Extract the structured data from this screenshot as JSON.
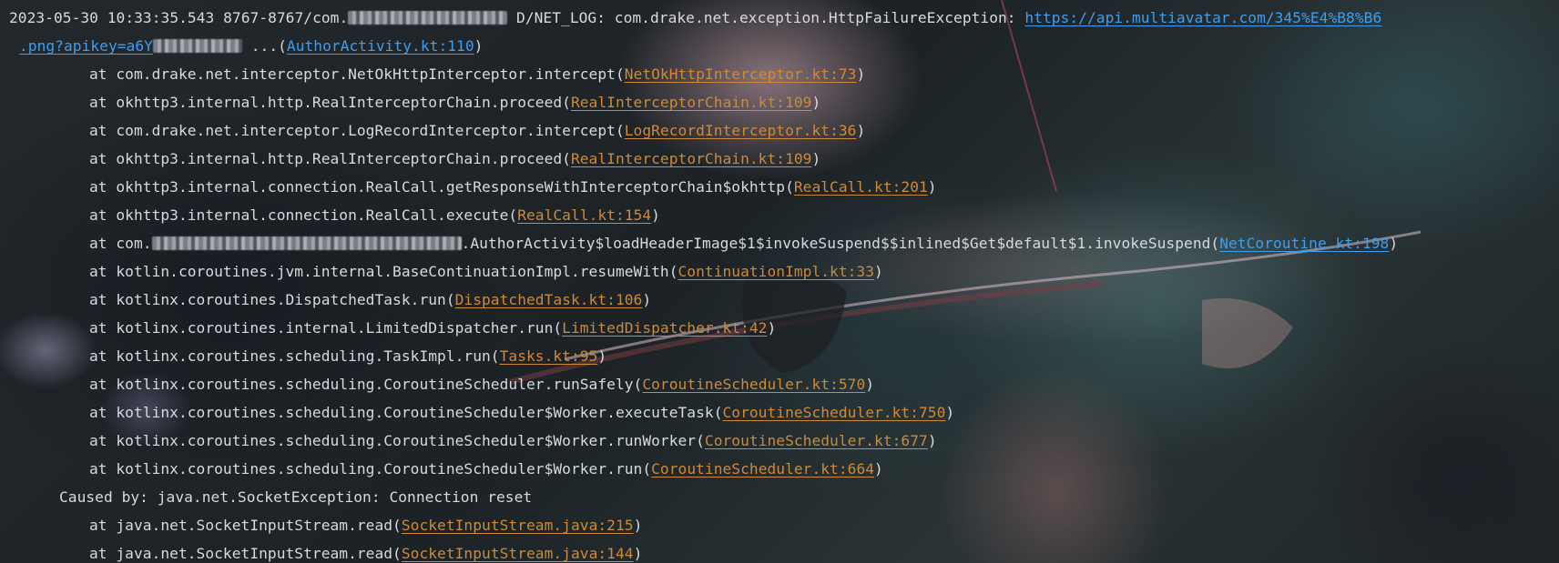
{
  "log": {
    "header": {
      "timestamp": "2023-05-30 10:33:35.543",
      "pid_prefix": "8767-8767/com.",
      "tag_text": " D/NET_LOG: com.drake.net.exception.HttpFailureException: ",
      "url_part1": "https://api.multiavatar.com/345%E4%B8%B6",
      "url_part2": ".png?apikey=a6Y",
      "after_key": " ...(",
      "author_link": "AuthorActivity.kt:110",
      "close": ")"
    },
    "stack": [
      {
        "method": "at com.drake.net.interceptor.NetOkHttpInterceptor.intercept(",
        "link": "NetOkHttpInterceptor.kt:73",
        "color": "orange"
      },
      {
        "method": "at okhttp3.internal.http.RealInterceptorChain.proceed(",
        "link": "RealInterceptorChain.kt:109",
        "color": "orange"
      },
      {
        "method": "at com.drake.net.interceptor.LogRecordInterceptor.intercept(",
        "link": "LogRecordInterceptor.kt:36",
        "color": "orange"
      },
      {
        "method": "at okhttp3.internal.http.RealInterceptorChain.proceed(",
        "link": "RealInterceptorChain.kt:109",
        "color": "orange"
      },
      {
        "method": "at okhttp3.internal.connection.RealCall.getResponseWithInterceptorChain$okhttp(",
        "link": "RealCall.kt:201",
        "color": "orange"
      },
      {
        "method": "at okhttp3.internal.connection.RealCall.execute(",
        "link": "RealCall.kt:154",
        "color": "orange"
      }
    ],
    "author_line": {
      "prefix": "at com.",
      "suffix": ".AuthorActivity$loadHeaderImage$1$invokeSuspend$$inlined$Get$default$1.invokeSuspend(",
      "link": "NetCoroutine.kt:198",
      "color": "blue"
    },
    "stack2": [
      {
        "method": "at kotlin.coroutines.jvm.internal.BaseContinuationImpl.resumeWith(",
        "link": "ContinuationImpl.kt:33",
        "color": "orange"
      },
      {
        "method": "at kotlinx.coroutines.DispatchedTask.run(",
        "link": "DispatchedTask.kt:106",
        "color": "orange"
      },
      {
        "method": "at kotlinx.coroutines.internal.LimitedDispatcher.run(",
        "link": "LimitedDispatcher.kt:42",
        "color": "orange"
      },
      {
        "method": "at kotlinx.coroutines.scheduling.TaskImpl.run(",
        "link": "Tasks.kt:95",
        "color": "orange"
      },
      {
        "method": "at kotlinx.coroutines.scheduling.CoroutineScheduler.runSafely(",
        "link": "CoroutineScheduler.kt:570",
        "color": "orange"
      },
      {
        "method": "at kotlinx.coroutines.scheduling.CoroutineScheduler$Worker.executeTask(",
        "link": "CoroutineScheduler.kt:750",
        "color": "orange"
      },
      {
        "method": "at kotlinx.coroutines.scheduling.CoroutineScheduler$Worker.runWorker(",
        "link": "CoroutineScheduler.kt:677",
        "color": "orange"
      },
      {
        "method": "at kotlinx.coroutines.scheduling.CoroutineScheduler$Worker.run(",
        "link": "CoroutineScheduler.kt:664",
        "color": "orange"
      }
    ],
    "caused_by": "Caused by: java.net.SocketException: Connection reset",
    "stack3": [
      {
        "method": "at java.net.SocketInputStream.read(",
        "link": "SocketInputStream.java:215",
        "color": "orange"
      },
      {
        "method": "at java.net.SocketInputStream.read(",
        "link": "SocketInputStream.java:144",
        "color": "orange"
      }
    ],
    "close_paren": ")"
  },
  "colors": {
    "text": "#d7dadf",
    "link_blue": "#3d9ef0",
    "link_orange": "#cc8a3a",
    "background": "#1c2024"
  }
}
